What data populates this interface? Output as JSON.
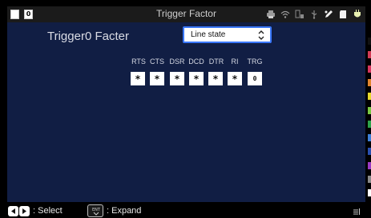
{
  "window": {
    "title": "Trigger Factor"
  },
  "statusbar": {
    "indicator_2": "0",
    "icons": [
      "printer-icon",
      "wifi-icon",
      "battery-charge-icon",
      "usb-icon",
      "edit-icon",
      "sd-card-icon",
      "power-plug-icon"
    ]
  },
  "main": {
    "heading": "Trigger0 Facter",
    "select": {
      "value": "Line state"
    },
    "signals": [
      {
        "label": "RTS",
        "value": "*"
      },
      {
        "label": "CTS",
        "value": "*"
      },
      {
        "label": "DSR",
        "value": "*"
      },
      {
        "label": "DCD",
        "value": "*"
      },
      {
        "label": "DTR",
        "value": "*"
      },
      {
        "label": "RI",
        "value": "*"
      },
      {
        "label": "TRG",
        "value": "0"
      }
    ]
  },
  "colors": {
    "panel_bg": "#111e44",
    "accent": "#3a78ff",
    "stripes": [
      "#111111",
      "#d33b55",
      "#d7365f",
      "#e2852e",
      "#e8d92c",
      "#7ac943",
      "#2da34a",
      "#3e7fd6",
      "#2a4fb0",
      "#9a3ac4",
      "#8a8a8a",
      "#ffffff"
    ]
  },
  "footer": {
    "select_label": ": Select",
    "enter_key": "ENT",
    "expand_label": ": Expand"
  }
}
